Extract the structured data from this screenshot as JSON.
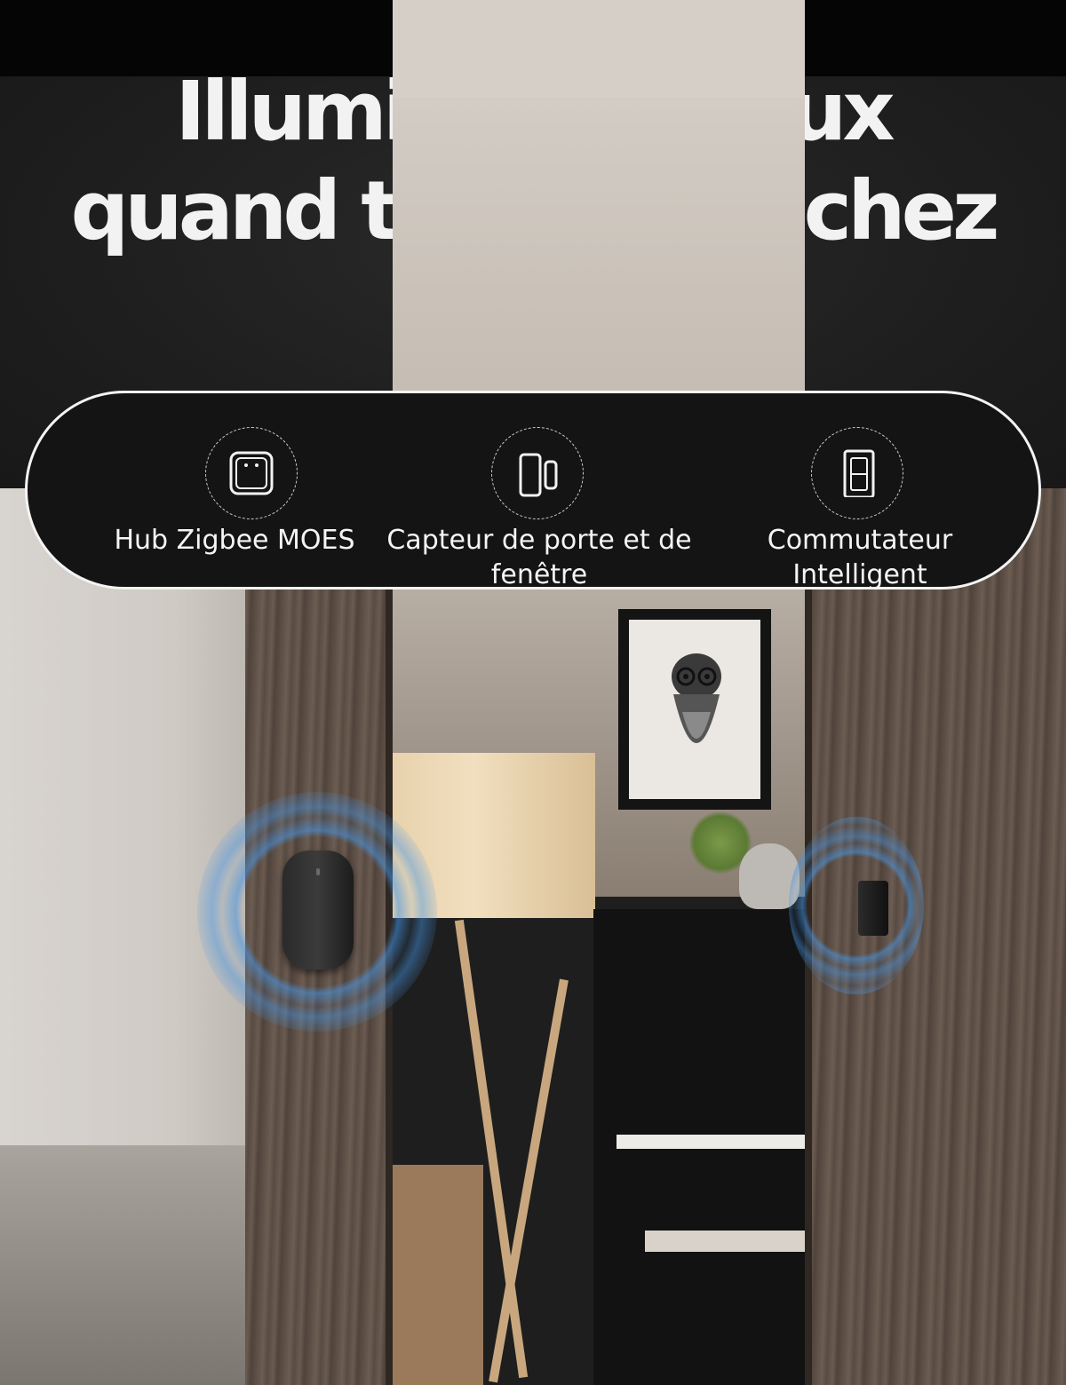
{
  "headline": {
    "line1": "Illumine tes yeux",
    "line2": "quand tu rentres chez toi."
  },
  "features": [
    {
      "label": "Hub Zigbee MOES",
      "icon": "hub-icon"
    },
    {
      "label": "Capteur de porte et de fenêtre",
      "icon": "door-sensor-icon"
    },
    {
      "label": "Commutateur Intelligent",
      "icon": "smart-switch-icon"
    }
  ],
  "colors": {
    "background_dark": "#1e1e1e",
    "text": "#f2f2f2",
    "signal_blue": "#4696e6"
  }
}
